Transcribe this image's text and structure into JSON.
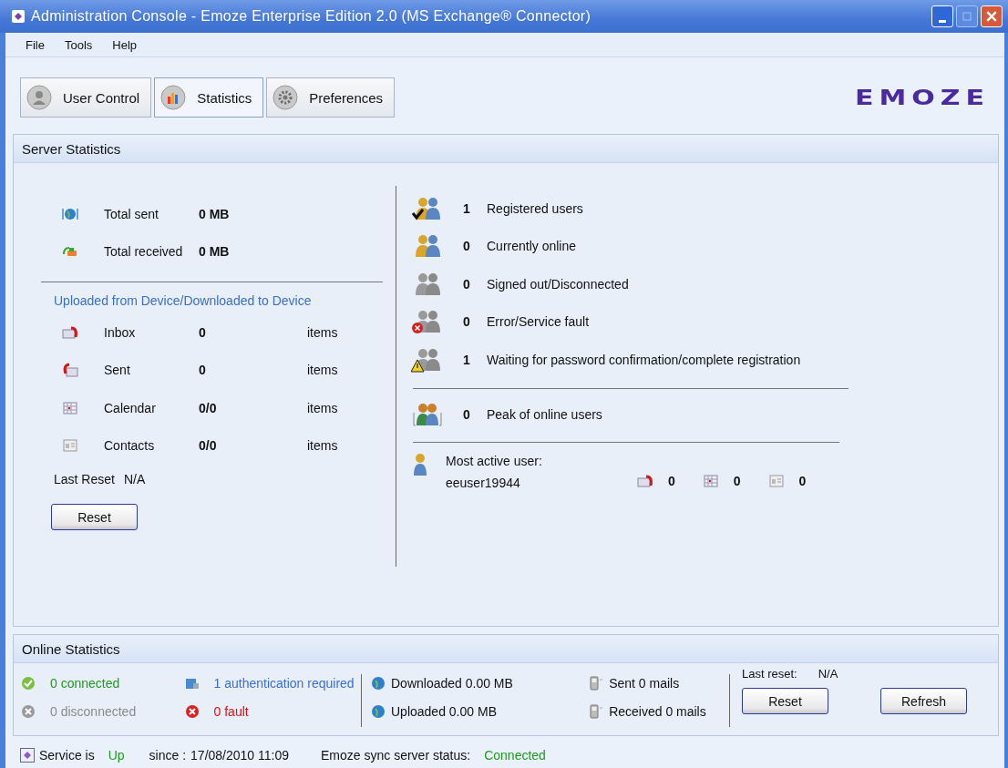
{
  "window": {
    "title": "Administration Console - Emoze Enterprise Edition 2.0 (MS Exchange® Connector)"
  },
  "menu": [
    "File",
    "Tools",
    "Help"
  ],
  "tabs": [
    {
      "label": "User Control",
      "selected": false,
      "kind": "user"
    },
    {
      "label": "Statistics",
      "selected": true,
      "kind": "chart"
    },
    {
      "label": "Preferences",
      "selected": false,
      "kind": "gear"
    }
  ],
  "logo": "EMOZE",
  "server_statistics": {
    "title": "Server Statistics",
    "totals": [
      {
        "kind": "sent",
        "label": "Total sent",
        "value": "0 MB"
      },
      {
        "kind": "received",
        "label": "Total received",
        "value": "0 MB"
      }
    ],
    "section_title": "Uploaded from Device/Downloaded to Device",
    "items": [
      {
        "kind": "inbox",
        "label": "Inbox",
        "value": "0",
        "unit": "items"
      },
      {
        "kind": "sent",
        "label": "Sent",
        "value": "0",
        "unit": "items"
      },
      {
        "kind": "calendar",
        "label": "Calendar",
        "value": "0/0",
        "unit": "items"
      },
      {
        "kind": "contacts",
        "label": "Contacts",
        "value": "0/0",
        "unit": "items"
      }
    ],
    "last_reset": {
      "label": "Last Reset",
      "value": "N/A"
    },
    "reset_button": "Reset",
    "users": [
      {
        "kind": "registered",
        "count": "1",
        "label": "Registered users"
      },
      {
        "kind": "online",
        "count": "0",
        "label": "Currently online"
      },
      {
        "kind": "signed_out",
        "count": "0",
        "label": "Signed out/Disconnected"
      },
      {
        "kind": "error",
        "count": "0",
        "label": "Error/Service fault"
      },
      {
        "kind": "waiting",
        "count": "1",
        "label": "Waiting for password confirmation/complete registration"
      }
    ],
    "peak": {
      "count": "0",
      "label": "Peak of online users"
    },
    "most_active": {
      "label": "Most active user:",
      "user": "eeuser19944",
      "counts": [
        {
          "kind": "inbox",
          "value": "0"
        },
        {
          "kind": "calendar",
          "value": "0"
        },
        {
          "kind": "contacts",
          "value": "0"
        }
      ]
    }
  },
  "online_statistics": {
    "title": "Online Statistics",
    "connections": [
      {
        "kind": "connected",
        "text": "0 connected"
      },
      {
        "kind": "auth",
        "text": "1 authentication required"
      },
      {
        "kind": "disconnected",
        "text": "0 disconnected"
      },
      {
        "kind": "fault",
        "text": "0 fault"
      }
    ],
    "traffic": [
      {
        "kind": "download",
        "text": "Downloaded 0.00 MB"
      },
      {
        "kind": "phone",
        "text": "Sent 0 mails"
      },
      {
        "kind": "upload",
        "text": "Uploaded 0.00 MB"
      },
      {
        "kind": "phone",
        "text": "Received 0 mails"
      }
    ],
    "last_reset": {
      "label": "Last reset:",
      "value": "N/A"
    },
    "buttons": [
      "Reset",
      "Refresh"
    ]
  },
  "status_bar": {
    "label": "Service is",
    "state": "Up",
    "since_label": "since :",
    "since": "17/08/2010 11:09",
    "sync_label": "Emoze sync server status:",
    "sync": "Connected"
  }
}
